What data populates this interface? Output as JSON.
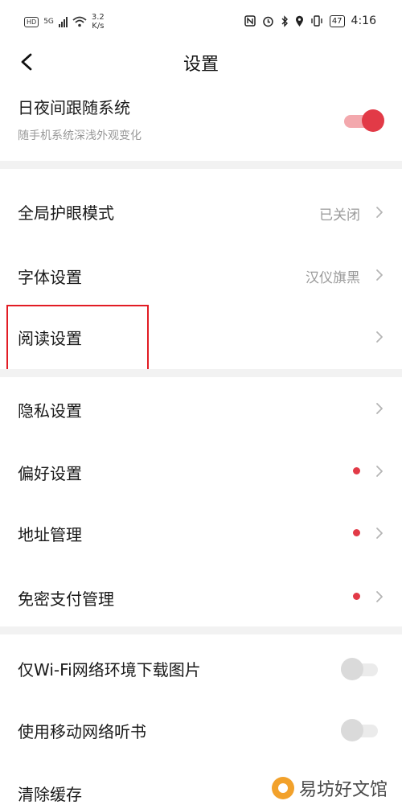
{
  "status_bar": {
    "hd": "HD",
    "network": "5G",
    "speed_value": "3.2",
    "speed_unit": "K/s",
    "battery": "47",
    "time": "4:16"
  },
  "header": {
    "title": "设置",
    "back_icon": "chevron-left-icon"
  },
  "day_night": {
    "label": "日夜间跟随系统",
    "sub": "随手机系统深浅外观变化",
    "enabled": true
  },
  "group1": [
    {
      "label": "全局护眼模式",
      "value": "已关闭"
    },
    {
      "label": "字体设置",
      "value": "汉仪旗黑"
    },
    {
      "label": "阅读设置",
      "value": ""
    }
  ],
  "group2": [
    {
      "label": "隐私设置",
      "dot": false
    },
    {
      "label": "偏好设置",
      "dot": true
    },
    {
      "label": "地址管理",
      "dot": true
    },
    {
      "label": "免密支付管理",
      "dot": true
    }
  ],
  "group3": [
    {
      "label": "仅Wi-Fi网络环境下载图片",
      "enabled": false
    },
    {
      "label": "使用移动网络听书",
      "enabled": false
    },
    {
      "label": "清除缓存"
    }
  ],
  "watermark": {
    "text": "易坊好文馆"
  },
  "colors": {
    "accent": "#e23a47",
    "highlight_box": "#e21c24"
  }
}
